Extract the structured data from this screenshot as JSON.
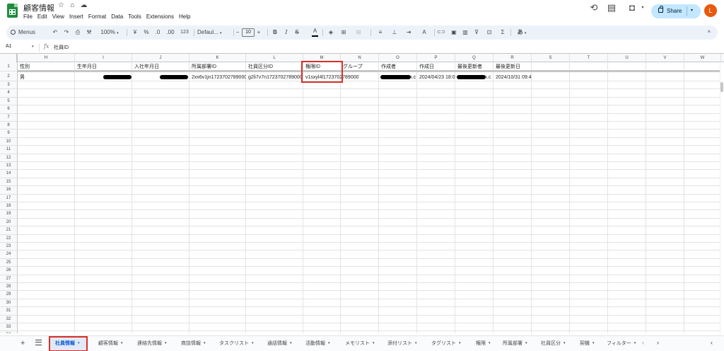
{
  "document": {
    "title": "顧客情報"
  },
  "menu": [
    "File",
    "Edit",
    "View",
    "Insert",
    "Format",
    "Data",
    "Tools",
    "Extensions",
    "Help"
  ],
  "header_actions": {
    "share_label": "Share",
    "avatar_initial": "L"
  },
  "toolbar": {
    "menus_label": "Menus",
    "undo": "↶",
    "redo": "↷",
    "print": "⎙",
    "paint": "⚒",
    "zoom": "100%",
    "currency": "¥",
    "percent": "%",
    "dec_decrease": ".0",
    "dec_increase": ".00",
    "number_format": "123",
    "font": "Defaul...",
    "minus": "−",
    "font_size": "10",
    "plus": "+",
    "bold": "B",
    "italic": "I",
    "strike": "S",
    "text_color": "A",
    "fill": "◈",
    "borders": "⊞",
    "merge": "⊟",
    "h_align": "≡",
    "v_align": "⊥",
    "wrap": "⇥",
    "rotate": "A",
    "link": "⊂⊃",
    "comment": "▣",
    "chart": "▥",
    "filter": "⊽",
    "views": "⊡",
    "functions": "Σ",
    "input_tools": "あ",
    "collapse": "^"
  },
  "formula_bar": {
    "cell_ref": "A1",
    "fx": "fx",
    "value": "社員ID"
  },
  "columns": [
    "H",
    "I",
    "J",
    "K",
    "L",
    "M",
    "N",
    "O",
    "P",
    "Q",
    "R",
    "S",
    "T",
    "U",
    "V",
    "W"
  ],
  "rows": {
    "row1": [
      "性別",
      "生年月日",
      "入社年月日",
      "所属部署ID",
      "社員区分ID",
      "権限ID",
      "グループ",
      "作成者",
      "作成日",
      "最後更新者",
      "最後更新日"
    ],
    "row2": {
      "gender": "男",
      "dept_id": "2xx6v1jn1723702789000",
      "class_id": "g2li7v7n1723702789000",
      "perm_id": "v1sxyl4l1723702789000",
      "creator_suffix": "n.c",
      "created": "2024/04/23 18:0",
      "updater_suffix": "n.c",
      "updated": "2024/10/31 09:4"
    }
  },
  "row_numbers": [
    "1",
    "2",
    "3",
    "4",
    "5",
    "6",
    "7",
    "8",
    "9",
    "10",
    "11",
    "12",
    "13",
    "14",
    "15",
    "16",
    "17",
    "18",
    "19",
    "20",
    "21",
    "22",
    "23",
    "24",
    "25",
    "26",
    "27",
    "28",
    "29",
    "30",
    "31",
    "32",
    "33",
    "34"
  ],
  "sheet_tabs": [
    "社員情報",
    "顧客情報",
    "連絡先情報",
    "商談情報",
    "タスクリスト",
    "通話情報",
    "活動情報",
    "メモリスト",
    "添付リスト",
    "タグリスト",
    "権限",
    "所属部署",
    "社員区分",
    "契機",
    "フィルター"
  ],
  "tab_controls": {
    "add": "+",
    "prev": "‹",
    "next": "›",
    "collapse": "‹"
  },
  "colors": {
    "accent": "#0b57d0",
    "share_bg": "#c2e7ff",
    "highlight": "#d93025",
    "avatar": "#e8590c"
  }
}
